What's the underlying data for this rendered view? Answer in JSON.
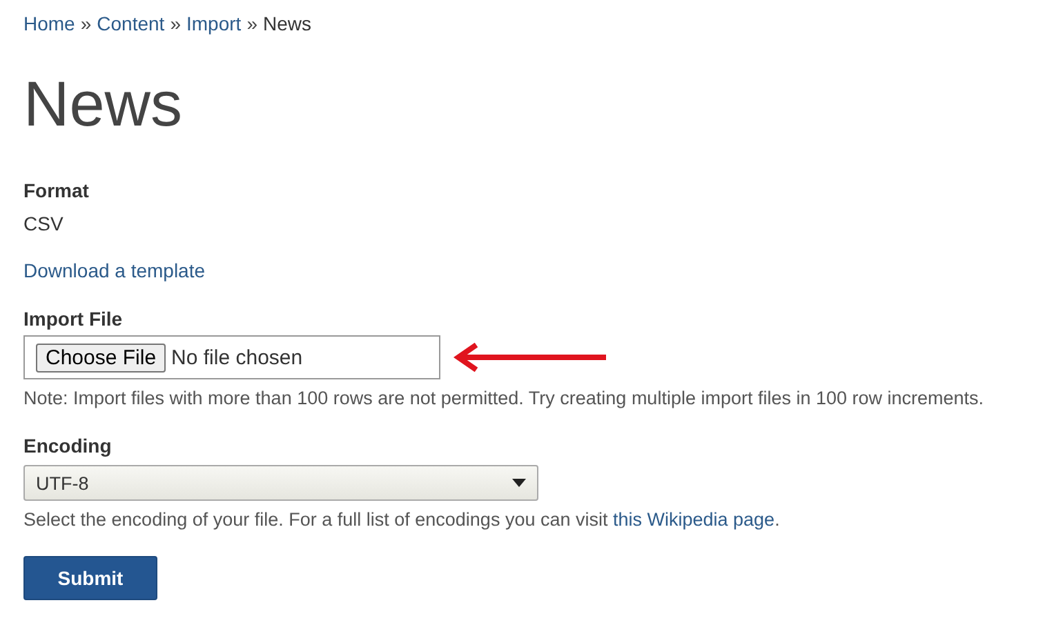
{
  "breadcrumb": [
    {
      "label": "Home",
      "link": true
    },
    {
      "label": "Content",
      "link": true
    },
    {
      "label": "Import",
      "link": true
    },
    {
      "label": "News",
      "link": false
    }
  ],
  "breadcrumb_separator": "»",
  "title": "News",
  "format": {
    "label": "Format",
    "value": "CSV"
  },
  "template_link": "Download a template",
  "import_file": {
    "label": "Import File",
    "button": "Choose File",
    "status": "No file chosen",
    "note": "Note: Import files with more than 100 rows are not permitted. Try creating multiple import files in 100 row increments."
  },
  "encoding": {
    "label": "Encoding",
    "value": "UTF-8",
    "help": "Select the encoding of your file. For a full list of encodings you can visit ",
    "help_link": "this Wikipedia page",
    "help_end": "."
  },
  "submit": "Submit"
}
